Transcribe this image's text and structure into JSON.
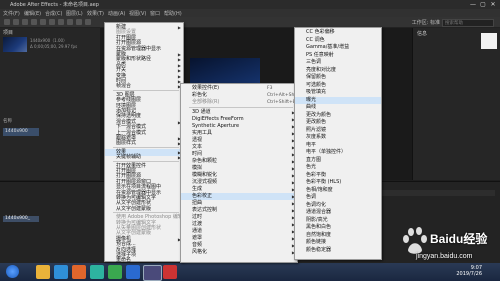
{
  "window": {
    "title": "Adobe After Effects - 未命名项目.aep",
    "controls": [
      "—",
      "▢",
      "✕"
    ]
  },
  "menubar": [
    "文件(F)",
    "编辑(E)",
    "合成(C)",
    "图层(L)",
    "效果(T)",
    "动画(A)",
    "视图(V)",
    "窗口",
    "帮助(H)"
  ],
  "toolbar": {
    "workspace_label": "工作区:",
    "workspace_value": "标准",
    "search_placeholder": "搜索帮助"
  },
  "project": {
    "title": "项目",
    "file_info_1": "1440x900（1.00）",
    "file_info_2": "Δ 0;00;05;00, 29.97 fps",
    "comp_name": "1440x900",
    "search_label": "名称",
    "row_label": "1440x900_"
  },
  "right_panel": {
    "tab": "信息"
  },
  "layer_menu": {
    "items": [
      {
        "label": "新建",
        "arrow": true
      },
      {
        "label": "图层设置",
        "disabled": true
      },
      {
        "label": "打开图层",
        "disabled": false
      },
      {
        "label": "打开图层源"
      },
      {
        "label": "在资源管理器中显示"
      },
      {
        "label": "蒙版",
        "arrow": true
      },
      {
        "label": "蒙版和形状路径",
        "arrow": true
      },
      {
        "label": "品质",
        "arrow": true
      },
      {
        "label": "开关",
        "arrow": true
      },
      {
        "label": "变换",
        "arrow": true
      },
      {
        "label": "时间",
        "arrow": true
      },
      {
        "label": "帧混合",
        "arrow": true
      },
      {
        "label": "3D 图层"
      },
      {
        "label": "参考线图层"
      },
      {
        "label": "环境图层"
      },
      {
        "label": "添加标记"
      },
      {
        "label": "保持透明度"
      },
      {
        "label": "混合模式",
        "arrow": true
      },
      {
        "label": "下一混合模式"
      },
      {
        "label": "上一混合模式"
      },
      {
        "label": "跟踪遮罩",
        "arrow": true
      },
      {
        "label": "图层样式",
        "arrow": true
      },
      {
        "label": "效果",
        "arrow": true,
        "highlight": true
      },
      {
        "label": "关键帧辅助",
        "arrow": true
      },
      {
        "label": "打开效果控件"
      },
      {
        "label": "打开图层"
      },
      {
        "label": "打开图层源"
      },
      {
        "label": "打开图层源窗口"
      },
      {
        "label": "显示在项目流程图中"
      },
      {
        "label": "在资源管理器中显示"
      },
      {
        "label": "转换为可编辑文字"
      },
      {
        "label": "从文字创建形状"
      },
      {
        "label": "从文字创建蒙版"
      },
      {
        "label": "使用 Adobe Photoshop 编辑",
        "disabled": true
      },
      {
        "label": "转换为可编辑文字",
        "disabled": true
      },
      {
        "label": "从矢量图层创建形状",
        "disabled": true
      },
      {
        "label": "从文字创建蒙版",
        "disabled": true
      },
      {
        "label": "摄像机",
        "arrow": true
      },
      {
        "label": "预合成..."
      },
      {
        "label": "反向选择"
      },
      {
        "label": "选择子项"
      },
      {
        "label": "重命名"
      }
    ]
  },
  "effect_menu": {
    "items": [
      {
        "label": "效果控件(E)",
        "shortcut": "F3"
      },
      {
        "label": "彩色化",
        "shortcut": "Ctrl+Alt+Shift+E"
      },
      {
        "label": "全部移除(R)",
        "shortcut": "Ctrl+Shift+E",
        "disabled": true
      },
      {
        "label": "3D 通道",
        "arrow": true
      },
      {
        "label": "DigiEffects FreeForm",
        "arrow": true
      },
      {
        "label": "Synthetic Aperture",
        "arrow": true
      },
      {
        "label": "实用工具",
        "arrow": true
      },
      {
        "label": "透视",
        "arrow": true
      },
      {
        "label": "文本",
        "arrow": true
      },
      {
        "label": "时间",
        "arrow": true
      },
      {
        "label": "杂色和颗粒",
        "arrow": true
      },
      {
        "label": "模拟",
        "arrow": true
      },
      {
        "label": "模糊和锐化",
        "arrow": true
      },
      {
        "label": "沉浸式视频",
        "arrow": true
      },
      {
        "label": "生成",
        "arrow": true
      },
      {
        "label": "色彩校正",
        "arrow": true,
        "highlight": true
      },
      {
        "label": "扭曲",
        "arrow": true
      },
      {
        "label": "表达式控制",
        "arrow": true
      },
      {
        "label": "过时",
        "arrow": true
      },
      {
        "label": "过渡",
        "arrow": true
      },
      {
        "label": "通道",
        "arrow": true
      },
      {
        "label": "遮罩",
        "arrow": true
      },
      {
        "label": "音频",
        "arrow": true
      },
      {
        "label": "风格化",
        "arrow": true
      }
    ]
  },
  "color_menu": {
    "items": [
      {
        "label": "CC 色彩偏移"
      },
      {
        "label": "CC 调色"
      },
      {
        "label": "Gamma/基准/增益"
      },
      {
        "label": "PS 任意映射"
      },
      {
        "label": "三色调"
      },
      {
        "label": "亮度和对比度"
      },
      {
        "label": "保留颜色"
      },
      {
        "label": "可选颜色"
      },
      {
        "label": "吸管填充"
      },
      {
        "label": "曝光",
        "highlight": true
      },
      {
        "label": "曲线"
      },
      {
        "label": "更改为颜色"
      },
      {
        "label": "更改颜色"
      },
      {
        "label": "照片滤镜"
      },
      {
        "label": "灰度系数"
      },
      {
        "label": "电平"
      },
      {
        "label": "电平（单独控件）"
      },
      {
        "label": "直方图"
      },
      {
        "label": "色光"
      },
      {
        "label": "色彩平衡"
      },
      {
        "label": "色彩平衡 (HLS)"
      },
      {
        "label": "色相/饱和度"
      },
      {
        "label": "色调"
      },
      {
        "label": "色调均化"
      },
      {
        "label": "通道混合器"
      },
      {
        "label": "阴影/高光"
      },
      {
        "label": "黑色和白色"
      },
      {
        "label": "自然饱和度"
      },
      {
        "label": "颜色链接"
      },
      {
        "label": "颜色稳定器"
      }
    ]
  },
  "taskbar": {
    "time": "9:07",
    "date": "2019/7/26"
  },
  "watermark": {
    "text": "Baidu经验",
    "url": "jingyan.baidu.com"
  },
  "colors": {
    "menu_bg": "#f0f0f0",
    "highlight": "#cfe3f7",
    "app_bg": "#1e1e1e"
  }
}
